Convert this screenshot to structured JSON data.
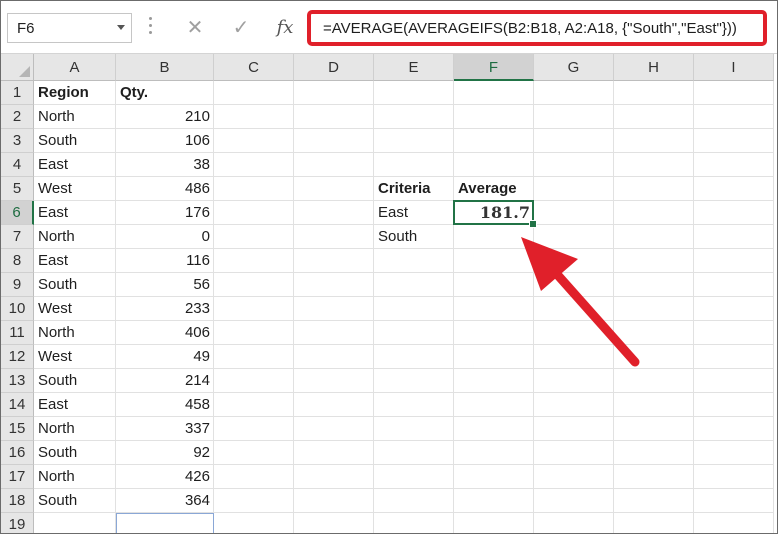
{
  "name_box": {
    "value": "F6"
  },
  "formula_bar": {
    "cancel_symbol": "✕",
    "enter_symbol": "✓",
    "fx_symbol": "fx",
    "formula": "=AVERAGE(AVERAGEIFS(B2:B18, A2:A18, {\"South\",\"East\"}))"
  },
  "columns": [
    "A",
    "B",
    "C",
    "D",
    "E",
    "F",
    "G",
    "H",
    "I"
  ],
  "rows": [
    "1",
    "2",
    "3",
    "4",
    "5",
    "6",
    "7",
    "8",
    "9",
    "10",
    "11",
    "12",
    "13",
    "14",
    "15",
    "16",
    "17",
    "18",
    "19"
  ],
  "cells": {
    "A1": "Region",
    "B1": "Qty.",
    "A2": "North",
    "B2": "210",
    "A3": "South",
    "B3": "106",
    "A4": "East",
    "B4": "38",
    "A5": "West",
    "B5": "486",
    "A6": "East",
    "B6": "176",
    "A7": "North",
    "B7": "0",
    "A8": "East",
    "B8": "116",
    "A9": "South",
    "B9": "56",
    "A10": "West",
    "B10": "233",
    "A11": "North",
    "B11": "406",
    "A12": "West",
    "B12": "49",
    "A13": "South",
    "B13": "214",
    "A14": "East",
    "B14": "458",
    "A15": "North",
    "B15": "337",
    "A16": "South",
    "B16": "92",
    "A17": "North",
    "B17": "426",
    "A18": "South",
    "B18": "364",
    "E5": "Criteria",
    "F5": "Average",
    "E6": "East",
    "F6": "181.7",
    "E7": "South"
  },
  "active_cell": "F6",
  "highlight_color": "#e0202a",
  "selection_color": "#217346"
}
